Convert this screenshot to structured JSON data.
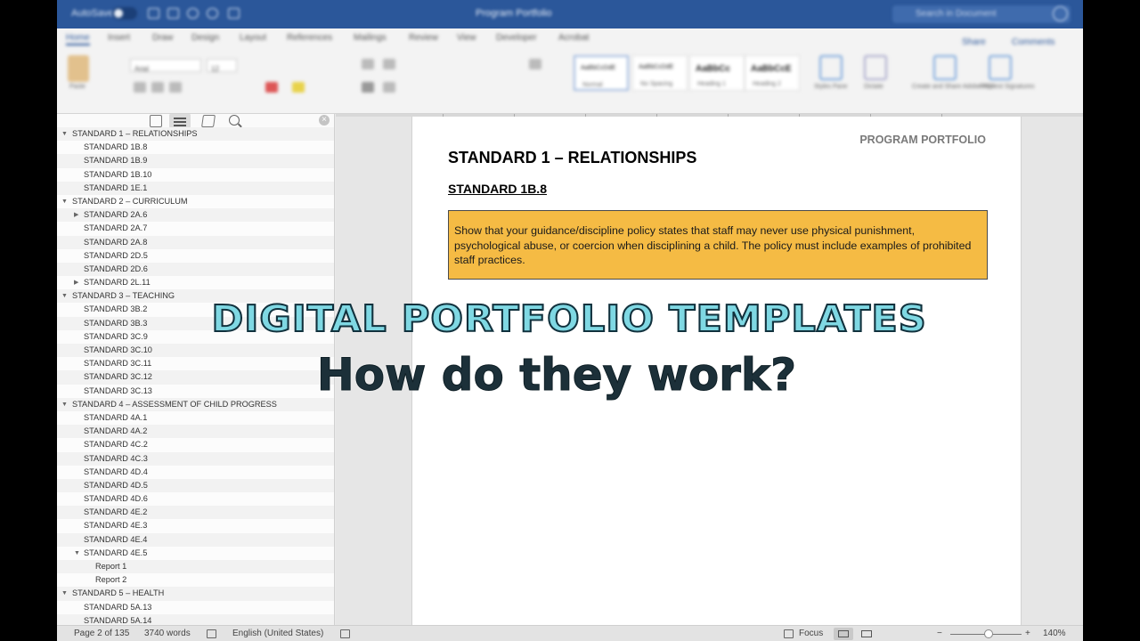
{
  "titlebar": {
    "autosave": "AutoSave",
    "doc_title": "Program Portfolio",
    "search_placeholder": "Search in Document"
  },
  "ribbon": {
    "tabs": [
      "Home",
      "Insert",
      "Draw",
      "Design",
      "Layout",
      "References",
      "Mailings",
      "Review",
      "View",
      "Developer",
      "Acrobat"
    ],
    "share": "Share",
    "comments": "Comments",
    "paste_label": "Paste",
    "font_name": "Arial",
    "font_size": "12",
    "styles": [
      {
        "preview": "AaBbCcDdE",
        "name": "Normal"
      },
      {
        "preview": "AaBbCcDdE",
        "name": "No Spacing"
      },
      {
        "preview": "AaBbCc",
        "name": "Heading 1"
      },
      {
        "preview": "AaBbCcE",
        "name": "Heading 2"
      }
    ],
    "styles_pane": "Styles Pane",
    "dictate": "Dictate",
    "create_pdf": "Create and Share Adobe PDF",
    "request_sig": "Request Signatures"
  },
  "nav": {
    "close": "×",
    "items": [
      {
        "label": "STANDARD 1 – RELATIONSHIPS",
        "level": 0,
        "arrow": "▼"
      },
      {
        "label": "STANDARD 1B.8",
        "level": 1,
        "arrow": ""
      },
      {
        "label": "STANDARD 1B.9",
        "level": 1,
        "arrow": ""
      },
      {
        "label": "STANDARD 1B.10",
        "level": 1,
        "arrow": ""
      },
      {
        "label": "STANDARD 1E.1",
        "level": 1,
        "arrow": ""
      },
      {
        "label": "STANDARD 2 – CURRICULUM",
        "level": 0,
        "arrow": "▼"
      },
      {
        "label": "STANDARD 2A.6",
        "level": 1,
        "arrow": "▶"
      },
      {
        "label": "STANDARD 2A.7",
        "level": 1,
        "arrow": ""
      },
      {
        "label": "STANDARD 2A.8",
        "level": 1,
        "arrow": ""
      },
      {
        "label": "STANDARD 2D.5",
        "level": 1,
        "arrow": ""
      },
      {
        "label": "STANDARD 2D.6",
        "level": 1,
        "arrow": ""
      },
      {
        "label": "STANDARD 2L.11",
        "level": 1,
        "arrow": "▶"
      },
      {
        "label": "STANDARD 3 – TEACHING",
        "level": 0,
        "arrow": "▼"
      },
      {
        "label": "STANDARD 3B.2",
        "level": 1,
        "arrow": ""
      },
      {
        "label": "STANDARD 3B.3",
        "level": 1,
        "arrow": ""
      },
      {
        "label": "STANDARD 3C.9",
        "level": 1,
        "arrow": ""
      },
      {
        "label": "STANDARD 3C.10",
        "level": 1,
        "arrow": ""
      },
      {
        "label": "STANDARD 3C.11",
        "level": 1,
        "arrow": ""
      },
      {
        "label": "STANDARD 3C.12",
        "level": 1,
        "arrow": ""
      },
      {
        "label": "STANDARD 3C.13",
        "level": 1,
        "arrow": ""
      },
      {
        "label": "STANDARD 4 – ASSESSMENT OF CHILD PROGRESS",
        "level": 0,
        "arrow": "▼"
      },
      {
        "label": "STANDARD 4A.1",
        "level": 1,
        "arrow": ""
      },
      {
        "label": "STANDARD 4A.2",
        "level": 1,
        "arrow": ""
      },
      {
        "label": "STANDARD 4C.2",
        "level": 1,
        "arrow": ""
      },
      {
        "label": "STANDARD 4C.3",
        "level": 1,
        "arrow": ""
      },
      {
        "label": "STANDARD 4D.4",
        "level": 1,
        "arrow": ""
      },
      {
        "label": "STANDARD 4D.5",
        "level": 1,
        "arrow": ""
      },
      {
        "label": "STANDARD 4D.6",
        "level": 1,
        "arrow": ""
      },
      {
        "label": "STANDARD 4E.2",
        "level": 1,
        "arrow": ""
      },
      {
        "label": "STANDARD 4E.3",
        "level": 1,
        "arrow": ""
      },
      {
        "label": "STANDARD 4E.4",
        "level": 1,
        "arrow": ""
      },
      {
        "label": "STANDARD 4E.5",
        "level": 1,
        "arrow": "▼"
      },
      {
        "label": "Report 1",
        "level": 2,
        "arrow": ""
      },
      {
        "label": "Report 2",
        "level": 2,
        "arrow": ""
      },
      {
        "label": "STANDARD 5 – HEALTH",
        "level": 0,
        "arrow": "▼"
      },
      {
        "label": "STANDARD 5A.13",
        "level": 1,
        "arrow": ""
      },
      {
        "label": "STANDARD 5A.14",
        "level": 1,
        "arrow": ""
      }
    ]
  },
  "document": {
    "header_right": "PROGRAM PORTFOLIO",
    "heading": "STANDARD 1 – RELATIONSHIPS",
    "subheading": "STANDARD 1B.8",
    "callout_text": "Show that your guidance/discipline policy states that staff may never use physical punishment, psychological abuse, or coercion when disciplining a child. The policy must include examples of prohibited staff practices.",
    "callout_color": "#f5bb44"
  },
  "overlay": {
    "title": "DIGITAL PORTFOLIO TEMPLATES",
    "subtitle": "How do they work?"
  },
  "statusbar": {
    "page": "Page 2 of 135",
    "words": "3740 words",
    "language": "English (United States)",
    "focus": "Focus",
    "zoom": "140%",
    "zoom_minus": "−",
    "zoom_plus": "+"
  }
}
